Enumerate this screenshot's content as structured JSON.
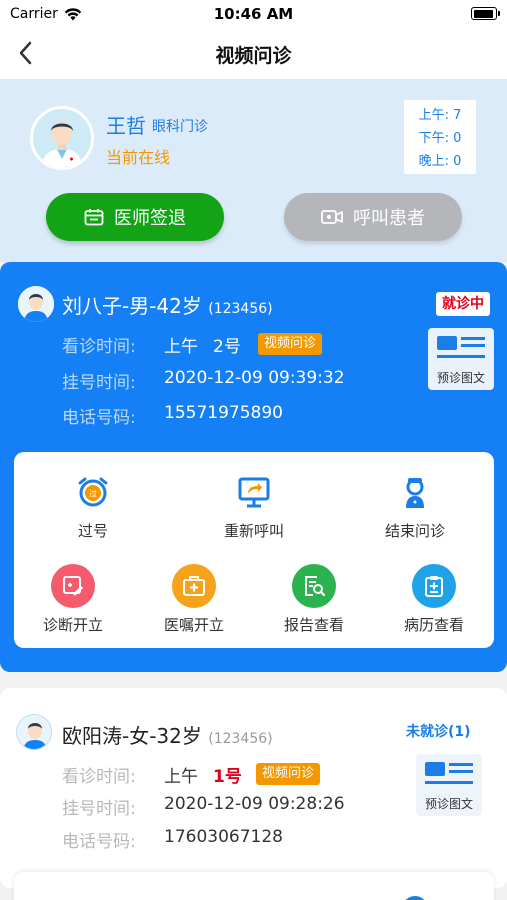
{
  "status_bar": {
    "carrier": "Carrier",
    "time": "10:46 AM"
  },
  "nav": {
    "title": "视频问诊"
  },
  "doctor": {
    "name": "王哲",
    "department": "眼科门诊",
    "status": "当前在线",
    "periods": [
      "上午: 7",
      "下午: 0",
      "晚上: 0"
    ],
    "signout_label": "医师签退",
    "call_label": "呼叫患者"
  },
  "active_patient": {
    "name": "刘八子-男-42岁",
    "id": "(123456)",
    "status": "就诊中",
    "visit_label": "看诊时间:",
    "visit_period": "上午",
    "visit_number": "2号",
    "tag": "视频问诊",
    "register_label": "挂号时间:",
    "register_time": "2020-12-09 09:39:32",
    "phone_label": "电话号码:",
    "phone": "15571975890",
    "pre_doc_label": "预诊图文"
  },
  "actions": [
    {
      "label": "过号",
      "icon": "alarm-clock-icon"
    },
    {
      "label": "重新呼叫",
      "icon": "monitor-recall-icon"
    },
    {
      "label": "结束问诊",
      "icon": "doctor-icon"
    },
    {
      "label": "诊断开立",
      "icon": "diagnosis-icon"
    },
    {
      "label": "医嘱开立",
      "icon": "medical-kit-icon"
    },
    {
      "label": "报告查看",
      "icon": "report-search-icon"
    },
    {
      "label": "病历查看",
      "icon": "clipboard-icon"
    }
  ],
  "second_patient": {
    "name": "欧阳涛-女-32岁",
    "id": "(123456)",
    "status": "未就诊(1)",
    "visit_label": "看诊时间:",
    "visit_period": "上午",
    "visit_number": "1号",
    "tag": "视频问诊",
    "register_label": "挂号时间:",
    "register_time": "2020-12-09 09:28:26",
    "phone_label": "电话号码:",
    "phone": "17603067128",
    "pre_doc_label": "预诊图文"
  },
  "colors": {
    "primary": "#1580f5",
    "orange": "#f39800",
    "green": "#12a316",
    "red": "#e0001b",
    "gray_button": "#b4b6b9"
  }
}
